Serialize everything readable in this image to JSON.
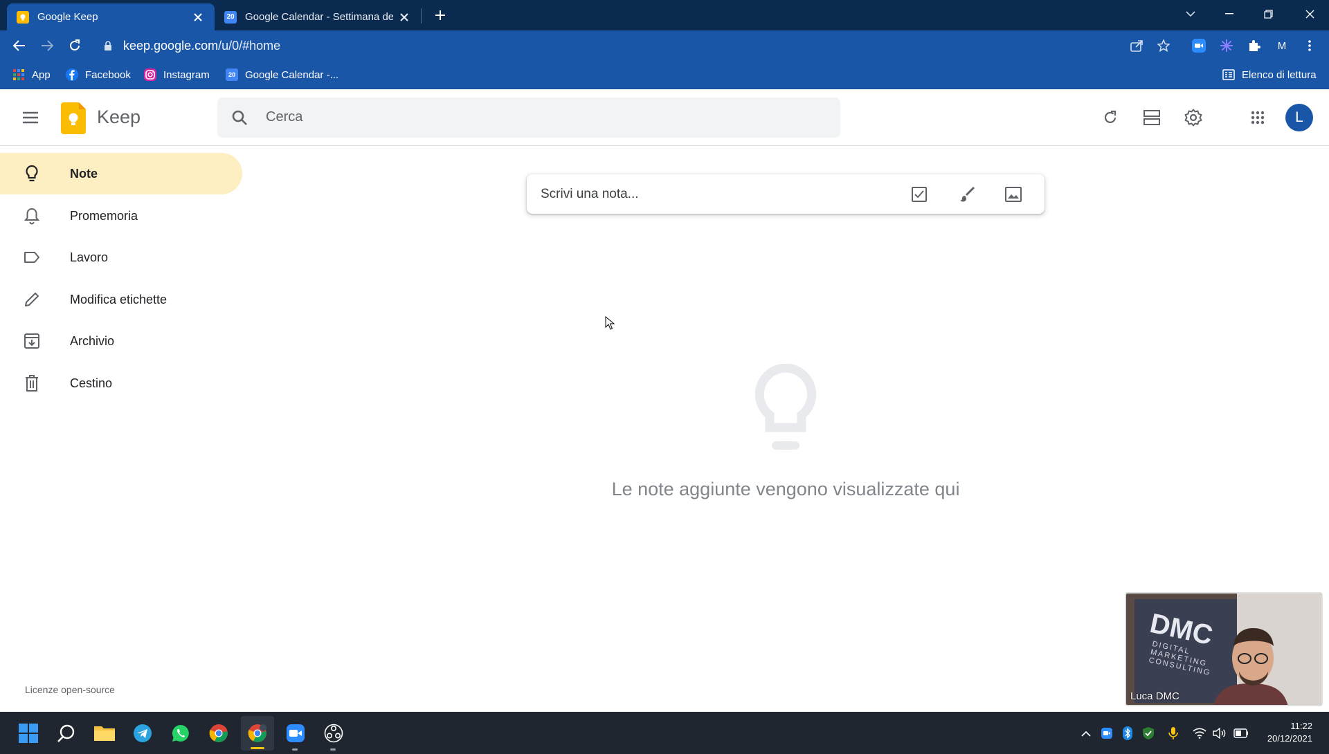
{
  "browser": {
    "tabs": [
      {
        "title": "Google Keep",
        "active": true
      },
      {
        "title": "Google Calendar - Settimana del",
        "favicon_text": "20",
        "active": false
      }
    ],
    "url_host": "keep.google.com",
    "url_path": "/u/0/#home",
    "profile_initial": "M",
    "bookmarks": [
      {
        "label": "App"
      },
      {
        "label": "Facebook"
      },
      {
        "label": "Instagram"
      },
      {
        "label": "Google Calendar -..."
      }
    ],
    "reading_list": "Elenco di lettura"
  },
  "keep": {
    "app_name": "Keep",
    "search_placeholder": "Cerca",
    "avatar_initial": "L",
    "nav": [
      {
        "label": "Note",
        "icon": "lightbulb-icon",
        "active": true
      },
      {
        "label": "Promemoria",
        "icon": "bell-icon"
      },
      {
        "label": "Lavoro",
        "icon": "label-icon"
      },
      {
        "label": "Modifica etichette",
        "icon": "pencil-icon"
      },
      {
        "label": "Archivio",
        "icon": "archive-icon"
      },
      {
        "label": "Cestino",
        "icon": "trash-icon"
      }
    ],
    "take_note_placeholder": "Scrivi una nota...",
    "empty_message": "Le note aggiunte vengono visualizzate qui",
    "footer_link": "Licenze open-source"
  },
  "video_overlay": {
    "name": "Luca DMC",
    "banner_title": "DMC",
    "banner_subtitle": "DIGITAL MARKETING CONSULTING"
  },
  "taskbar": {
    "time": "11:22",
    "date": "20/12/2021"
  },
  "colors": {
    "tab_bar": "#0b2a4f",
    "toolbar": "#1a56a8",
    "keep_yellow": "#fbbc04",
    "active_nav": "#feefc3",
    "avatar": "#1a56a8"
  }
}
